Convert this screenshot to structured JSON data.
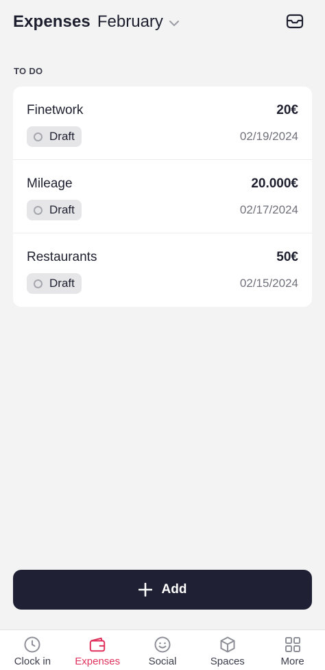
{
  "header": {
    "title": "Expenses",
    "month": "February"
  },
  "icons": {
    "month_dropdown": "chevron-down-icon",
    "inbox": "inbox-icon"
  },
  "section": {
    "label": "TO DO"
  },
  "expenses": [
    {
      "name": "Finetwork",
      "amount": "20€",
      "status": "Draft",
      "date": "02/19/2024"
    },
    {
      "name": "Mileage",
      "amount": "20.000€",
      "status": "Draft",
      "date": "02/17/2024"
    },
    {
      "name": "Restaurants",
      "amount": "50€",
      "status": "Draft",
      "date": "02/15/2024"
    }
  ],
  "add_button": {
    "label": "Add"
  },
  "bottom_nav": {
    "items": [
      {
        "label": "Clock in",
        "icon": "clock-icon",
        "active": false
      },
      {
        "label": "Expenses",
        "icon": "wallet-icon",
        "active": true
      },
      {
        "label": "Social",
        "icon": "smiley-icon",
        "active": false
      },
      {
        "label": "Spaces",
        "icon": "cube-icon",
        "active": false
      },
      {
        "label": "More",
        "icon": "grid-icon",
        "active": false
      }
    ]
  },
  "colors": {
    "background": "#f3f3f4",
    "text": "#1e1f2e",
    "accent": "#e0325c",
    "button": "#1f2033",
    "badge": "#e6e6e8"
  }
}
